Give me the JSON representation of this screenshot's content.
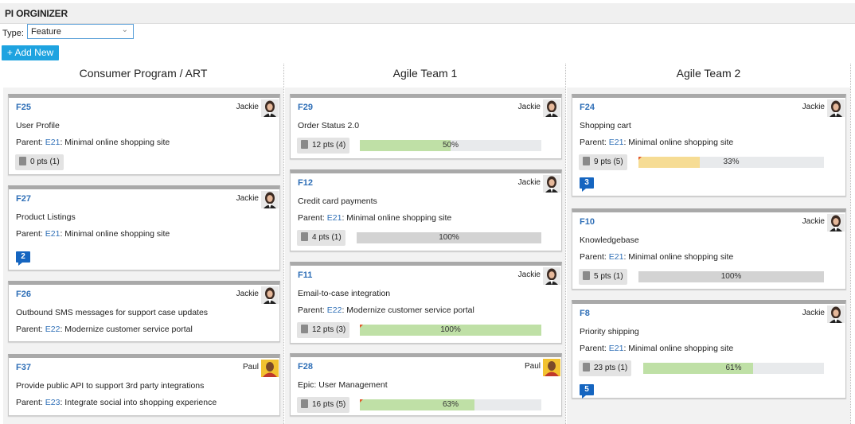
{
  "header": {
    "title": "PI ORGINIZER"
  },
  "filter": {
    "type_label": "Type:",
    "type_value": "Feature"
  },
  "toolbar": {
    "add_label": "+ Add New"
  },
  "columns": [
    {
      "title": "Consumer Program / ART"
    },
    {
      "title": "Agile Team 1"
    },
    {
      "title": "Agile Team 2"
    }
  ],
  "cards": [
    {
      "id": "F25",
      "owner": "Jackie",
      "avatar": "female",
      "title": "User Profile",
      "parent_label": "Parent:",
      "parent_id": "E21",
      "parent_name": ": Minimal online shopping site",
      "points": "0 pts (1)"
    },
    {
      "id": "F27",
      "owner": "Jackie",
      "avatar": "female",
      "title": "Product Listings",
      "parent_label": "Parent:",
      "parent_id": "E21",
      "parent_name": ": Minimal online shopping site",
      "comments": "2"
    },
    {
      "id": "F26",
      "owner": "Jackie",
      "avatar": "female",
      "title": "Outbound SMS messages for support case updates",
      "parent_label": "Parent:",
      "parent_id": "E22",
      "parent_name": ": Modernize customer service portal"
    },
    {
      "id": "F37",
      "owner": "Paul",
      "avatar": "male",
      "title": "Provide public API to support 3rd party integrations",
      "parent_label": "Parent:",
      "parent_id": "E23",
      "parent_name": ": Integrate social into shopping experience"
    },
    {
      "id": "F29",
      "owner": "Jackie",
      "avatar": "female",
      "title": "Order Status 2.0",
      "points": "12 pts (4)",
      "progress": 0.5,
      "progress_label": "50%",
      "bar_color": "#bfe0a6"
    },
    {
      "id": "F12",
      "owner": "Jackie",
      "avatar": "female",
      "title": "Credit card payments",
      "parent_label": "Parent:",
      "parent_id": "E21",
      "parent_name": ": Minimal online shopping site",
      "points": "4 pts (1)",
      "progress": 1.0,
      "progress_label": "100%",
      "bar_color": "#d3d3d3"
    },
    {
      "id": "F11",
      "owner": "Jackie",
      "avatar": "female",
      "title": "Email-to-case integration",
      "parent_label": "Parent:",
      "parent_id": "E22",
      "parent_name": ": Modernize customer service portal",
      "points": "12 pts (3)",
      "progress": 1.0,
      "progress_label": "100%",
      "bar_color": "#bfe0a6",
      "flag": true
    },
    {
      "id": "F28",
      "owner": "Paul",
      "avatar": "male",
      "title": "Epic: User Management",
      "points": "16 pts (5)",
      "progress": 0.63,
      "progress_label": "63%",
      "bar_color": "#bfe0a6",
      "flag": true
    },
    {
      "id": "F24",
      "owner": "Jackie",
      "avatar": "female",
      "title": "Shopping cart",
      "parent_label": "Parent:",
      "parent_id": "E21",
      "parent_name": ": Minimal online shopping site",
      "points": "9 pts (5)",
      "progress": 0.33,
      "progress_label": "33%",
      "bar_color": "#f6dc94",
      "flag": true,
      "comments": "3"
    },
    {
      "id": "F10",
      "owner": "Jackie",
      "avatar": "female",
      "title": "Knowledgebase",
      "parent_label": "Parent:",
      "parent_id": "E21",
      "parent_name": ": Minimal online shopping site",
      "points": "5 pts (1)",
      "progress": 1.0,
      "progress_label": "100%",
      "bar_color": "#d3d3d3"
    },
    {
      "id": "F8",
      "owner": "Jackie",
      "avatar": "female",
      "title": "Priority shipping",
      "parent_label": "Parent:",
      "parent_id": "E21",
      "parent_name": ": Minimal online shopping site",
      "points": "23 pts (1)",
      "progress": 0.61,
      "progress_label": "61%",
      "bar_color": "#bfe0a6",
      "comments": "5"
    }
  ]
}
